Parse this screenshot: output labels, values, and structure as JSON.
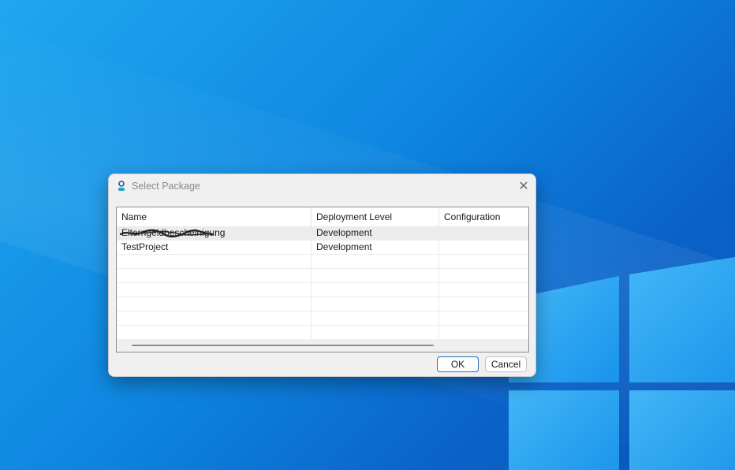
{
  "dialog": {
    "title": "Select Package",
    "close_label": "✕",
    "columns": [
      "Name",
      "Deployment Level",
      "Configuration"
    ],
    "rows": [
      {
        "name": "Elterngeldbescheinigung",
        "deployment_level": "Development",
        "configuration": "",
        "selected": true,
        "redacted": true
      },
      {
        "name": "TestProject",
        "deployment_level": "Development",
        "configuration": "",
        "selected": false,
        "redacted": false
      }
    ],
    "ok_label": "OK",
    "cancel_label": "Cancel"
  },
  "colors": {
    "desktop_blue": "#0e86e0",
    "dialog_bg": "#f0f0f0",
    "ok_border": "#1f6fb5"
  }
}
